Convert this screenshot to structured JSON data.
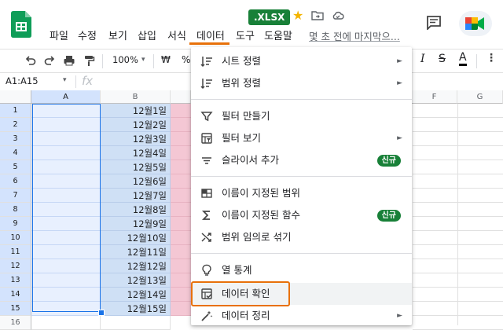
{
  "app": {
    "file_badge": ".XLSX",
    "menu": [
      "파일",
      "수정",
      "보기",
      "삽입",
      "서식",
      "데이터",
      "도구",
      "도움말"
    ],
    "active_menu": "데이터",
    "last_edit": "몇 초 전에 마지막으..."
  },
  "toolbar": {
    "zoom": "100%",
    "currency": "₩",
    "percent": "%",
    "right_icons": [
      "italic-icon",
      "strikethrough-icon",
      "text-color-icon",
      "more-icon"
    ]
  },
  "formula_bar": {
    "name_box": "A1:A15",
    "fx": "fx"
  },
  "grid": {
    "columns_left": [
      "A",
      "B"
    ],
    "columns_right": [
      "F",
      "G"
    ],
    "rows": [
      "1",
      "2",
      "3",
      "4",
      "5",
      "6",
      "7",
      "8",
      "9",
      "10",
      "11",
      "12",
      "13",
      "14",
      "15",
      "16"
    ],
    "b_values": [
      "12월1일",
      "12월2일",
      "12월3일",
      "12월4일",
      "12월5일",
      "12월6일",
      "12월7일",
      "12월8일",
      "12월9일",
      "12월10일",
      "12월11일",
      "12월12일",
      "12월13일",
      "12월14일",
      "12월15일"
    ]
  },
  "data_menu": {
    "items": [
      {
        "label": "시트 정렬",
        "icon": "sort-icon",
        "submenu": true
      },
      {
        "label": "범위 정렬",
        "icon": "sort-range-icon",
        "submenu": true
      },
      {
        "label": "필터 만들기",
        "icon": "filter-icon"
      },
      {
        "label": "필터 보기",
        "icon": "filter-view-icon",
        "submenu": true
      },
      {
        "label": "슬라이서 추가",
        "icon": "slicer-icon",
        "badge": "신규"
      },
      {
        "label": "이름이 지정된 범위",
        "icon": "named-range-icon"
      },
      {
        "label": "이름이 지정된 함수",
        "icon": "sigma-icon",
        "badge": "신규"
      },
      {
        "label": "범위 임의로 섞기",
        "icon": "shuffle-icon"
      },
      {
        "label": "열 통계",
        "icon": "lightbulb-icon"
      },
      {
        "label": "데이터 확인",
        "icon": "data-validation-icon"
      },
      {
        "label": "데이터 정리",
        "icon": "magic-wand-icon",
        "submenu": true
      }
    ],
    "submenu_arrow": "►"
  },
  "colors": {
    "accent": "#e8710a",
    "badge_green": "#188038",
    "selection_blue": "#1a73e8"
  }
}
